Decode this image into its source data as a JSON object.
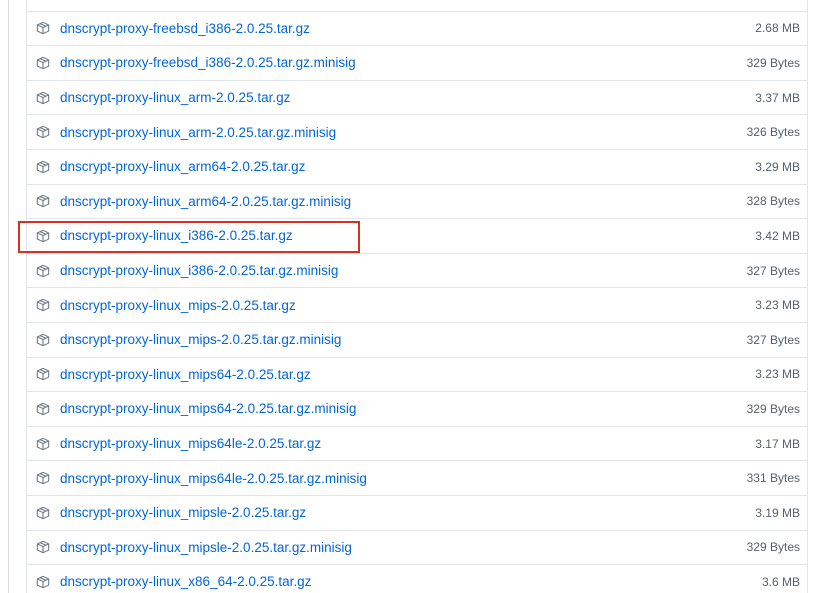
{
  "assets": [
    {
      "name": "dnscrypt-proxy-freebsd_i386-2.0.25.tar.gz",
      "size": "2.68 MB",
      "icon": "package-icon",
      "highlighted": false
    },
    {
      "name": "dnscrypt-proxy-freebsd_i386-2.0.25.tar.gz.minisig",
      "size": "329 Bytes",
      "icon": "package-icon",
      "highlighted": false
    },
    {
      "name": "dnscrypt-proxy-linux_arm-2.0.25.tar.gz",
      "size": "3.37 MB",
      "icon": "package-icon",
      "highlighted": false
    },
    {
      "name": "dnscrypt-proxy-linux_arm-2.0.25.tar.gz.minisig",
      "size": "326 Bytes",
      "icon": "package-icon",
      "highlighted": false
    },
    {
      "name": "dnscrypt-proxy-linux_arm64-2.0.25.tar.gz",
      "size": "3.29 MB",
      "icon": "package-icon",
      "highlighted": false
    },
    {
      "name": "dnscrypt-proxy-linux_arm64-2.0.25.tar.gz.minisig",
      "size": "328 Bytes",
      "icon": "package-icon",
      "highlighted": false
    },
    {
      "name": "dnscrypt-proxy-linux_i386-2.0.25.tar.gz",
      "size": "3.42 MB",
      "icon": "package-icon",
      "highlighted": true
    },
    {
      "name": "dnscrypt-proxy-linux_i386-2.0.25.tar.gz.minisig",
      "size": "327 Bytes",
      "icon": "package-icon",
      "highlighted": false
    },
    {
      "name": "dnscrypt-proxy-linux_mips-2.0.25.tar.gz",
      "size": "3.23 MB",
      "icon": "package-icon",
      "highlighted": false
    },
    {
      "name": "dnscrypt-proxy-linux_mips-2.0.25.tar.gz.minisig",
      "size": "327 Bytes",
      "icon": "package-icon",
      "highlighted": false
    },
    {
      "name": "dnscrypt-proxy-linux_mips64-2.0.25.tar.gz",
      "size": "3.23 MB",
      "icon": "package-icon",
      "highlighted": false
    },
    {
      "name": "dnscrypt-proxy-linux_mips64-2.0.25.tar.gz.minisig",
      "size": "329 Bytes",
      "icon": "package-icon",
      "highlighted": false
    },
    {
      "name": "dnscrypt-proxy-linux_mips64le-2.0.25.tar.gz",
      "size": "3.17 MB",
      "icon": "package-icon",
      "highlighted": false
    },
    {
      "name": "dnscrypt-proxy-linux_mips64le-2.0.25.tar.gz.minisig",
      "size": "331 Bytes",
      "icon": "package-icon",
      "highlighted": false
    },
    {
      "name": "dnscrypt-proxy-linux_mipsle-2.0.25.tar.gz",
      "size": "3.19 MB",
      "icon": "package-icon",
      "highlighted": false
    },
    {
      "name": "dnscrypt-proxy-linux_mipsle-2.0.25.tar.gz.minisig",
      "size": "329 Bytes",
      "icon": "package-icon",
      "highlighted": false
    },
    {
      "name": "dnscrypt-proxy-linux_x86_64-2.0.25.tar.gz",
      "size": "3.6 MB",
      "icon": "package-icon",
      "highlighted": false
    }
  ],
  "colors": {
    "link": "#0366d6",
    "size_text": "#586069",
    "border": "#e1e4e8",
    "highlight": "#d93025",
    "icon": "#6a737d"
  }
}
